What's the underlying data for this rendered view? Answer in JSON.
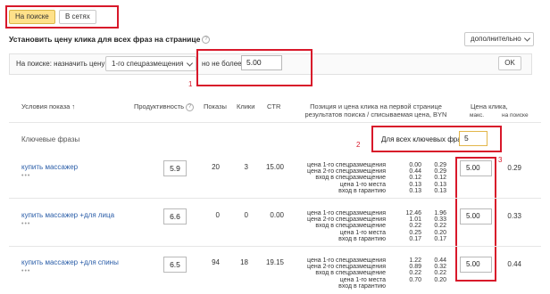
{
  "tabs": [
    {
      "label": "На поиске",
      "active": true
    },
    {
      "label": "В сетях",
      "active": false
    }
  ],
  "bulk_section": {
    "title": "Установить цену клика для всех фраз на странице",
    "mode_dropdown": "дополнительно",
    "label_left": "На поиске: назначить цену",
    "position_dropdown": "1-го спецразмещения",
    "limit_label": "но не более",
    "limit_value": "5.00",
    "ok_label": "OK"
  },
  "annotations": [
    "1",
    "2",
    "3"
  ],
  "table": {
    "headers": {
      "conditions": "Условия показа ↑",
      "productivity": "Продуктивность",
      "shows": "Показы",
      "clicks": "Клики",
      "ctr": "CTR",
      "position_line1": "Позиция и цена клика на первой странице",
      "position_line2": "результатов поиска / списываемая цена, BYN",
      "bid_title": "Цена клика,",
      "bid_max": "макс.",
      "bid_on_search": "на поиске"
    },
    "group_label": "Ключевые фразы",
    "all_phrases_label": "Для всех ключевых фраз:",
    "all_phrases_value": "5",
    "rows": [
      {
        "phrase": "купить массажер",
        "dots": "•••",
        "productivity": "5.9",
        "shows": "20",
        "clicks": "3",
        "ctr": "15.00",
        "positions": [
          "цена 1-го спецразмещения",
          "цена 2-го спецразмещения",
          "вход в спецразмещение",
          "цена 1-го места",
          "вход в гарантию"
        ],
        "bids": [
          "0.00",
          "0.44",
          "0.12",
          "0.13",
          "0.13"
        ],
        "charged": [
          "0.29",
          "0.29",
          "0.12",
          "0.13",
          "0.13"
        ],
        "max_bid": "5.00",
        "search_price": "0.29"
      },
      {
        "phrase": "купить массажер +для лица",
        "dots": "•••",
        "productivity": "6.6",
        "shows": "0",
        "clicks": "0",
        "ctr": "0.00",
        "positions": [
          "цена 1-го спецразмещения",
          "цена 2-го спецразмещения",
          "вход в спецразмещение",
          "цена 1-го места",
          "вход в гарантию"
        ],
        "bids": [
          "12.46",
          "1.01",
          "0.22",
          "0.25",
          "0.17"
        ],
        "charged": [
          "1.96",
          "0.33",
          "0.22",
          "0.20",
          "0.17"
        ],
        "max_bid": "5.00",
        "search_price": "0.33"
      },
      {
        "phrase": "купить массажер +для спины",
        "dots": "•••",
        "productivity": "6.5",
        "shows": "94",
        "clicks": "18",
        "ctr": "19.15",
        "positions": [
          "цена 1-го спецразмещения",
          "цена 2-го спецразмещения",
          "вход в спецразмещение",
          "цена 1-го места",
          "вход в гарантию"
        ],
        "bids": [
          "1.22",
          "0.89",
          "0.22",
          "0.70",
          ""
        ],
        "charged": [
          "0.44",
          "0.32",
          "0.22",
          "0.20",
          ""
        ],
        "max_bid": "5.00",
        "search_price": "0.44"
      }
    ]
  },
  "colors": {
    "highlight_box": "#d8182a",
    "active_tab": "#ffe18a",
    "link": "#2a5da8"
  }
}
